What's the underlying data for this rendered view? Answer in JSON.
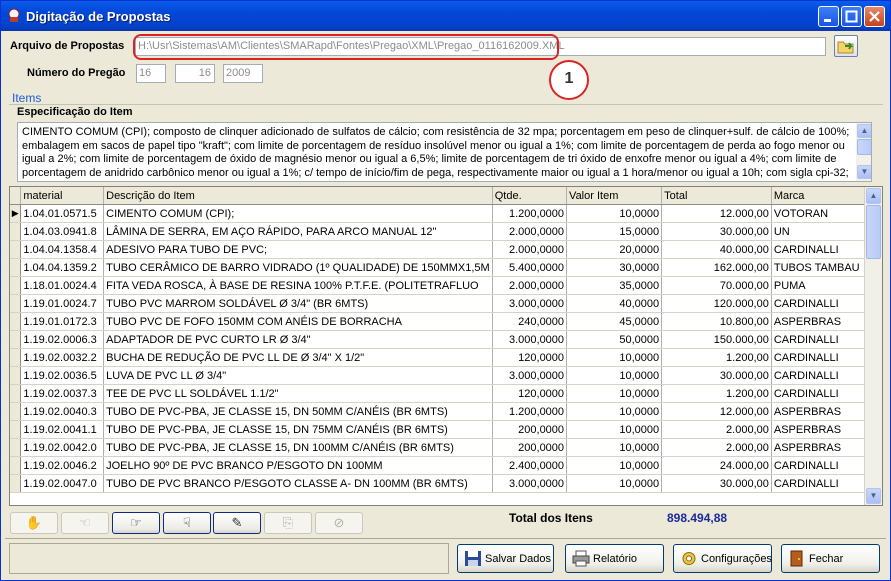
{
  "window": {
    "title": "Digitação de Propostas"
  },
  "form": {
    "arquivo_label": "Arquivo de Propostas",
    "arquivo_value": "H:\\Usr\\Sistemas\\AM\\Clientes\\SMARapd\\Fontes\\Pregao\\XML\\Pregao_0116162009.XML",
    "pregao_label": "Número do Pregão",
    "pregao_1": "16",
    "pregao_2": "16",
    "pregao_3": "2009",
    "annotation_number": "1"
  },
  "items": {
    "group_label": "Items",
    "spec_label": "Especificação do Item",
    "spec_text": "CIMENTO COMUM (CPI); composto de clinquer adicionado de sulfatos de cálcio; com resistência de 32 mpa; porcentagem em peso de clinquer+sulf. de cálcio de 100%; embalagem em sacos de papel tipo \"kraft\"; com limite de porcentagem de resíduo insolúvel menor ou igual a 1%; com limite de porcentagem de perda ao fogo menor ou igual a 2%; com limite de porcentagem de óxido de magnésio menor ou igual a 6,5%; limite de porcentagem de tri óxido de enxofre menor ou igual a 4%; com limite de porcentagem de anidrido carbônico menor ou igual a 1%; c/ tempo de início/fim de pega, respectivamente maior ou igual a 1 hora/menor ou igual a 10h; com sigla cpi-32;"
  },
  "grid": {
    "columns": [
      "material",
      "Descrição do Item",
      "Qtde.",
      "Valor Item",
      "Total",
      "Marca"
    ],
    "rows": [
      [
        "1.04.01.0571.5",
        "CIMENTO COMUM (CPI);",
        "1.200,0000",
        "10,0000",
        "12.000,00",
        "VOTORAN"
      ],
      [
        "1.04.03.0941.8",
        "LÂMINA DE SERRA, EM AÇO RÁPIDO, PARA ARCO MANUAL 12\"",
        "2.000,0000",
        "15,0000",
        "30.000,00",
        "UN"
      ],
      [
        "1.04.04.1358.4",
        "ADESIVO PARA TUBO DE PVC;",
        "2.000,0000",
        "20,0000",
        "40.000,00",
        "CARDINALLI"
      ],
      [
        "1.04.04.1359.2",
        "TUBO CERÂMICO DE BARRO VIDRADO (1º QUALIDADE) DE 150MMX1,5M",
        "5.400,0000",
        "30,0000",
        "162.000,00",
        "TUBOS TAMBAU"
      ],
      [
        "1.18.01.0024.4",
        "FITA VEDA ROSCA, À BASE DE RESINA 100% P.T.F.E. (POLITETRAFLUO",
        "2.000,0000",
        "35,0000",
        "70.000,00",
        "PUMA"
      ],
      [
        "1.19.01.0024.7",
        "TUBO PVC MARROM SOLDÁVEL Ø 3/4\" (BR 6MTS)",
        "3.000,0000",
        "40,0000",
        "120.000,00",
        "CARDINALLI"
      ],
      [
        "1.19.01.0172.3",
        "TUBO PVC DE FOFO 150MM COM ANÉIS DE BORRACHA",
        "240,0000",
        "45,0000",
        "10.800,00",
        "ASPERBRAS"
      ],
      [
        "1.19.02.0006.3",
        "ADAPTADOR DE PVC CURTO LR Ø 3/4\"",
        "3.000,0000",
        "50,0000",
        "150.000,00",
        "CARDINALLI"
      ],
      [
        "1.19.02.0032.2",
        "BUCHA DE REDUÇÃO DE PVC LL DE Ø 3/4\" X 1/2\"",
        "120,0000",
        "10,0000",
        "1.200,00",
        "CARDINALLI"
      ],
      [
        "1.19.02.0036.5",
        "LUVA DE PVC LL Ø 3/4\"",
        "3.000,0000",
        "10,0000",
        "30.000,00",
        "CARDINALLI"
      ],
      [
        "1.19.02.0037.3",
        "TEE DE PVC LL SOLDÁVEL 1.1/2\"",
        "120,0000",
        "10,0000",
        "1.200,00",
        "CARDINALLI"
      ],
      [
        "1.19.02.0040.3",
        "TUBO DE PVC-PBA, JE CLASSE 15, DN 50MM C/ANÉIS (BR 6MTS)",
        "1.200,0000",
        "10,0000",
        "12.000,00",
        "ASPERBRAS"
      ],
      [
        "1.19.02.0041.1",
        "TUBO DE PVC-PBA, JE CLASSE 15, DN 75MM C/ANÉIS (BR 6MTS)",
        "200,0000",
        "10,0000",
        "2.000,00",
        "ASPERBRAS"
      ],
      [
        "1.19.02.0042.0",
        "TUBO DE PVC-PBA, JE CLASSE 15, DN 100MM C/ANÉIS (BR 6MTS)",
        "200,0000",
        "10,0000",
        "2.000,00",
        "ASPERBRAS"
      ],
      [
        "1.19.02.0046.2",
        "JOELHO 90º DE PVC BRANCO P/ESGOTO DN 100MM",
        "2.400,0000",
        "10,0000",
        "24.000,00",
        "CARDINALLI"
      ],
      [
        "1.19.02.0047.0",
        "TUBO DE PVC BRANCO P/ESGOTO CLASSE A- DN 100MM (BR 6MTS)",
        "3.000,0000",
        "10,0000",
        "30.000,00",
        "CARDINALLI"
      ]
    ]
  },
  "totals": {
    "label": "Total dos Itens",
    "value": "898.494,88"
  },
  "buttons": {
    "salvar": "Salvar Dados",
    "relatorio": "Relatório",
    "config": "Configurações",
    "fechar": "Fechar"
  }
}
